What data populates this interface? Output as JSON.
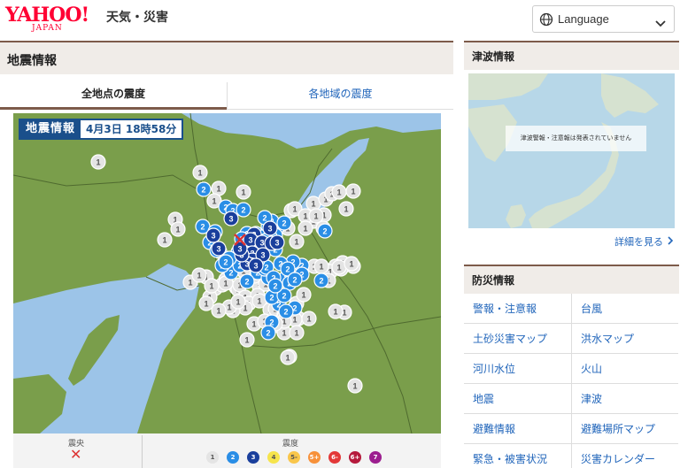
{
  "header": {
    "logo_text": "YAHOO!",
    "logo_sub": "JAPAN",
    "service_name": "天気・災害",
    "language_label": "Language"
  },
  "main": {
    "title": "地震情報",
    "tabs": [
      {
        "label": "全地点の震度",
        "active": true
      },
      {
        "label": "各地域の震度",
        "active": false
      }
    ],
    "map_badge": {
      "title": "地震情報",
      "time": "4月3日 18時58分"
    },
    "legend": {
      "epicenter_label": "震央",
      "epicenter_mark": "✕",
      "intensity_label": "震度",
      "scale": [
        {
          "label": "1",
          "bg": "#e4e4e4",
          "fg": "#555555"
        },
        {
          "label": "2",
          "bg": "#2a8ee6",
          "fg": "#ffffff"
        },
        {
          "label": "3",
          "bg": "#1a3f9c",
          "fg": "#ffffff"
        },
        {
          "label": "4",
          "bg": "#f6e44c",
          "fg": "#555555"
        },
        {
          "label": "5-",
          "bg": "#f9c64b",
          "fg": "#555555"
        },
        {
          "label": "5+",
          "bg": "#f7913a",
          "fg": "#ffffff"
        },
        {
          "label": "6-",
          "bg": "#e33838",
          "fg": "#ffffff"
        },
        {
          "label": "6+",
          "bg": "#b51a3c",
          "fg": "#ffffff"
        },
        {
          "label": "7",
          "bg": "#9c1e8f",
          "fg": "#ffffff"
        }
      ]
    },
    "intensity_markers": {
      "1": [
        [
          96,
          55
        ],
        [
          211,
          67
        ],
        [
          232,
          85
        ],
        [
          260,
          89
        ],
        [
          227,
          99
        ],
        [
          183,
          120
        ],
        [
          171,
          143
        ],
        [
          186,
          131
        ],
        [
          200,
          191
        ],
        [
          218,
          185
        ],
        [
          210,
          183
        ],
        [
          240,
          188
        ],
        [
          252,
          197
        ],
        [
          254,
          199
        ],
        [
          228,
          198
        ],
        [
          236,
          194
        ],
        [
          222,
          208
        ],
        [
          224,
          195
        ],
        [
          240,
          192
        ],
        [
          256,
          194
        ],
        [
          278,
          196
        ],
        [
          285,
          193
        ],
        [
          272,
          184
        ],
        [
          268,
          179
        ],
        [
          262,
          208
        ],
        [
          276,
          206
        ],
        [
          266,
          215
        ],
        [
          278,
          212
        ],
        [
          290,
          222
        ],
        [
          296,
          221
        ],
        [
          299,
          240
        ],
        [
          306,
          227
        ],
        [
          320,
          215
        ],
        [
          328,
          205
        ],
        [
          340,
          173
        ],
        [
          339,
          122
        ],
        [
          339,
          102
        ],
        [
          351,
          115
        ],
        [
          353,
          97
        ],
        [
          360,
          91
        ],
        [
          368,
          89
        ],
        [
          376,
          108
        ],
        [
          384,
          88
        ],
        [
          384,
          173
        ],
        [
          372,
          169
        ],
        [
          364,
          173
        ],
        [
          358,
          179
        ],
        [
          370,
          176
        ],
        [
          348,
          173
        ],
        [
          356,
          189
        ],
        [
          368,
          174
        ],
        [
          382,
          170
        ],
        [
          276,
          173
        ],
        [
          248,
          174
        ],
        [
          260,
          178
        ],
        [
          288,
          122
        ],
        [
          314,
          110
        ],
        [
          318,
          108
        ],
        [
          330,
          116
        ],
        [
          342,
          116
        ],
        [
          272,
          238
        ],
        [
          262,
          220
        ],
        [
          248,
          223
        ],
        [
          244,
          219
        ],
        [
          232,
          223
        ],
        [
          254,
          213
        ],
        [
          284,
          235
        ],
        [
          306,
          248
        ],
        [
          306,
          230
        ],
        [
          322,
          232
        ],
        [
          318,
          233
        ],
        [
          306,
          235
        ],
        [
          334,
          232
        ],
        [
          374,
          225
        ],
        [
          364,
          224
        ],
        [
          312,
          275
        ],
        [
          310,
          276
        ],
        [
          386,
          308
        ],
        [
          218,
          215
        ],
        [
          320,
          145
        ],
        [
          290,
          130
        ],
        [
          310,
          130
        ],
        [
          330,
          130
        ],
        [
          350,
          130
        ],
        [
          264,
          256
        ],
        [
          320,
          248
        ],
        [
          296,
          238
        ]
      ],
      "2": [
        [
          215,
          86
        ],
        [
          240,
          106
        ],
        [
          248,
          110
        ],
        [
          260,
          109
        ],
        [
          214,
          128
        ],
        [
          228,
          134
        ],
        [
          233,
          156
        ],
        [
          222,
          146
        ],
        [
          254,
          157
        ],
        [
          296,
          132
        ],
        [
          262,
          150
        ],
        [
          264,
          136
        ],
        [
          258,
          142
        ],
        [
          230,
          155
        ],
        [
          300,
          127
        ],
        [
          288,
          128
        ],
        [
          274,
          136
        ],
        [
          280,
          140
        ],
        [
          292,
          122
        ],
        [
          284,
          118
        ],
        [
          306,
          124
        ],
        [
          296,
          138
        ],
        [
          285,
          144
        ],
        [
          246,
          180
        ],
        [
          256,
          172
        ],
        [
          276,
          180
        ],
        [
          264,
          190
        ],
        [
          288,
          186
        ],
        [
          296,
          196
        ],
        [
          308,
          186
        ],
        [
          326,
          172
        ],
        [
          316,
          168
        ],
        [
          302,
          170
        ],
        [
          312,
          192
        ],
        [
          284,
          176
        ],
        [
          244,
          164
        ],
        [
          236,
          172
        ],
        [
          240,
          168
        ],
        [
          286,
          174
        ],
        [
          296,
          154
        ],
        [
          310,
          176
        ],
        [
          352,
          133
        ],
        [
          294,
          186
        ],
        [
          276,
          166
        ],
        [
          348,
          189
        ],
        [
          326,
          182
        ],
        [
          318,
          220
        ],
        [
          300,
          216
        ],
        [
          292,
          208
        ],
        [
          318,
          188
        ],
        [
          306,
          206
        ],
        [
          296,
          195
        ],
        [
          292,
          236
        ],
        [
          288,
          248
        ],
        [
          308,
          224
        ]
      ],
      "3": [
        [
          226,
          138
        ],
        [
          232,
          153
        ],
        [
          246,
          119
        ],
        [
          272,
          137
        ],
        [
          276,
          147
        ],
        [
          268,
          143
        ],
        [
          270,
          158
        ],
        [
          270,
          166
        ],
        [
          264,
          170
        ],
        [
          281,
          146
        ],
        [
          292,
          147
        ],
        [
          298,
          146
        ],
        [
          290,
          130
        ],
        [
          282,
          160
        ],
        [
          274,
          172
        ],
        [
          258,
          160
        ],
        [
          256,
          153
        ]
      ]
    },
    "epicenter_marker": [
      256,
      143
    ]
  },
  "side": {
    "tsunami": {
      "title": "津波情報",
      "message": "津波警報・注意報は発表されていません",
      "more_link": "詳細を見る"
    },
    "bousai": {
      "title": "防災情報",
      "items": [
        "警報・注意報",
        "台風",
        "土砂災害マップ",
        "洪水マップ",
        "河川水位",
        "火山",
        "地震",
        "津波",
        "避難情報",
        "避難場所マップ",
        "緊急・被害状況",
        "災害カレンダー"
      ]
    }
  },
  "colors": {
    "accent_brown": "#7d5b4a",
    "link_blue": "#2266bb",
    "badge_blue": "#1a4f8b",
    "land_green": "#7a9e4b",
    "water_blue": "#9cc4e8",
    "logo_red": "#ff0033"
  },
  "icons": {
    "globe": "globe-icon",
    "chevron": "chevron-down-icon",
    "more_arrow": "chevron-right-icon"
  }
}
